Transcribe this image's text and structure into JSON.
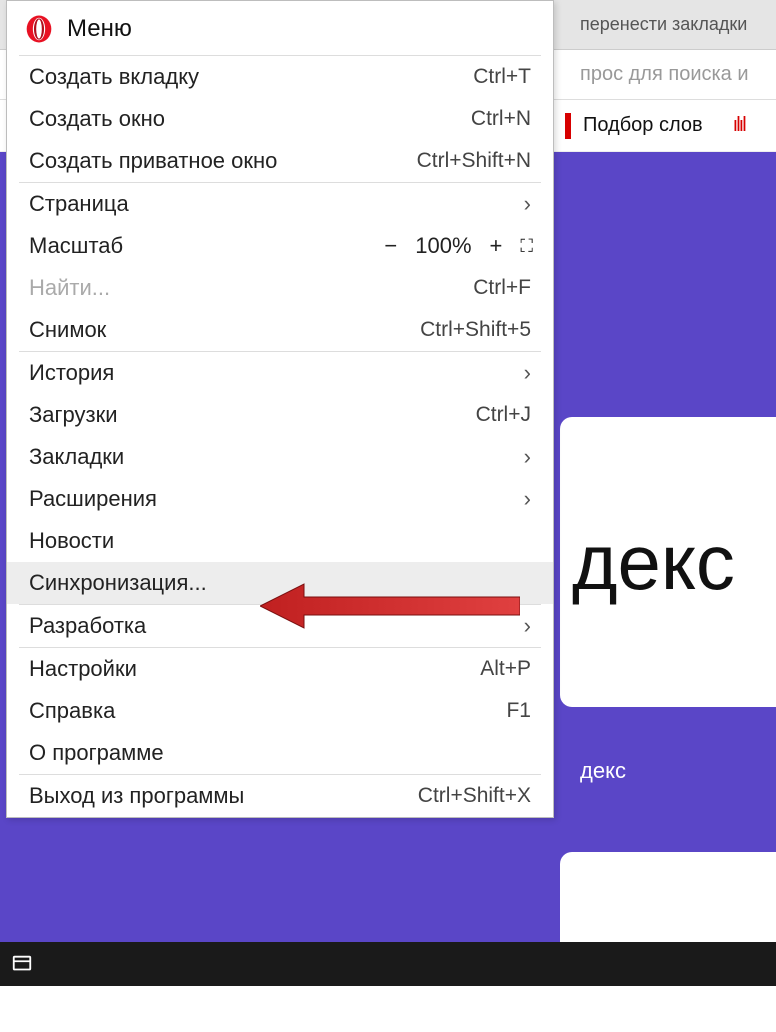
{
  "background": {
    "tab_text": "перенести закладки",
    "addr_placeholder": "прос для поиска и",
    "toolbar_item": "Подбор слов",
    "card_big_text": "декс",
    "card_label": "декс"
  },
  "menu": {
    "title": "Меню",
    "sections": [
      [
        {
          "label": "Создать вкладку",
          "shortcut": "Ctrl+T"
        },
        {
          "label": "Создать окно",
          "shortcut": "Ctrl+N"
        },
        {
          "label": "Создать приватное окно",
          "shortcut": "Ctrl+Shift+N"
        }
      ],
      [
        {
          "label": "Страница",
          "submenu": true
        },
        {
          "label": "Масштаб",
          "zoom": true,
          "zoom_value": "100%"
        },
        {
          "label": "Найти...",
          "shortcut": "Ctrl+F",
          "disabled": true
        },
        {
          "label": "Снимок",
          "shortcut": "Ctrl+Shift+5"
        }
      ],
      [
        {
          "label": "История",
          "submenu": true
        },
        {
          "label": "Загрузки",
          "shortcut": "Ctrl+J"
        },
        {
          "label": "Закладки",
          "submenu": true
        },
        {
          "label": "Расширения",
          "submenu": true
        },
        {
          "label": "Новости"
        },
        {
          "label": "Синхронизация...",
          "highlighted": true
        }
      ],
      [
        {
          "label": "Разработка",
          "submenu": true
        }
      ],
      [
        {
          "label": "Настройки",
          "shortcut": "Alt+P"
        },
        {
          "label": "Справка",
          "shortcut": "F1"
        },
        {
          "label": "О программе"
        }
      ],
      [
        {
          "label": "Выход из программы",
          "shortcut": "Ctrl+Shift+X"
        }
      ]
    ]
  }
}
